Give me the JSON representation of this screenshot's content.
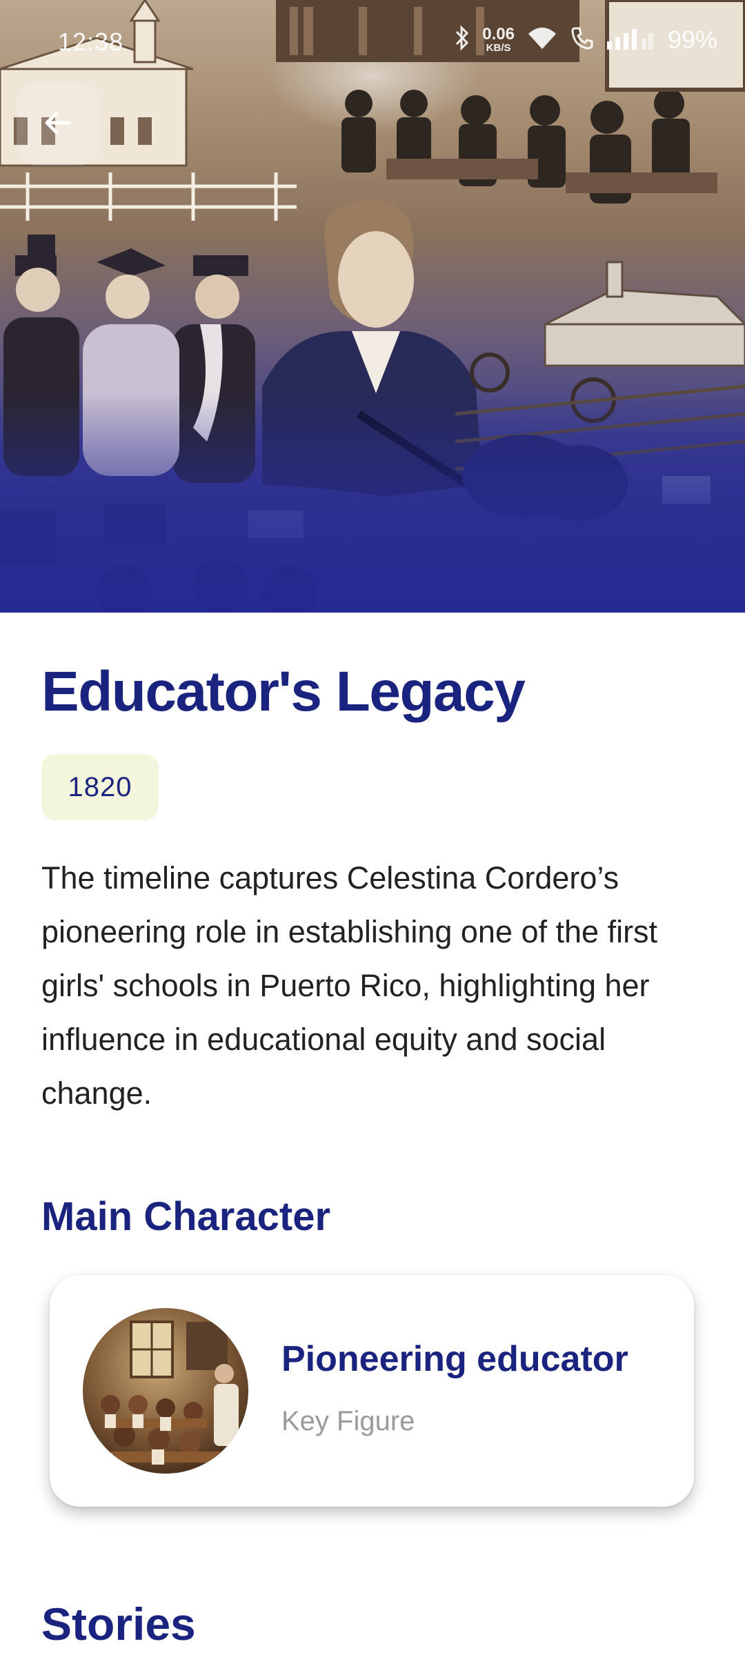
{
  "status_bar": {
    "time": "12:38",
    "net_speed_value": "0.06",
    "net_speed_unit": "KB/S",
    "battery": "99%",
    "icons": [
      "bluetooth-icon",
      "wifi-icon",
      "call-icon",
      "signal-icon",
      "battery-icon"
    ]
  },
  "header": {
    "back_icon": "arrow-back-icon"
  },
  "main": {
    "title": "Educator's Legacy",
    "year": "1820",
    "description": "The timeline captures Celestina Cordero’s pioneering role in establishing one of the first girls' schools in Puerto Rico, highlighting her influence in educational equity and social change."
  },
  "main_character": {
    "section_title": "Main Character",
    "name": "Pioneering educator",
    "role": "Key Figure"
  },
  "stories": {
    "section_title": "Stories"
  },
  "colors": {
    "accent": "#1a237e",
    "chip_background": "#f3f6dd",
    "hero_overlay": "#2c2f8f"
  }
}
